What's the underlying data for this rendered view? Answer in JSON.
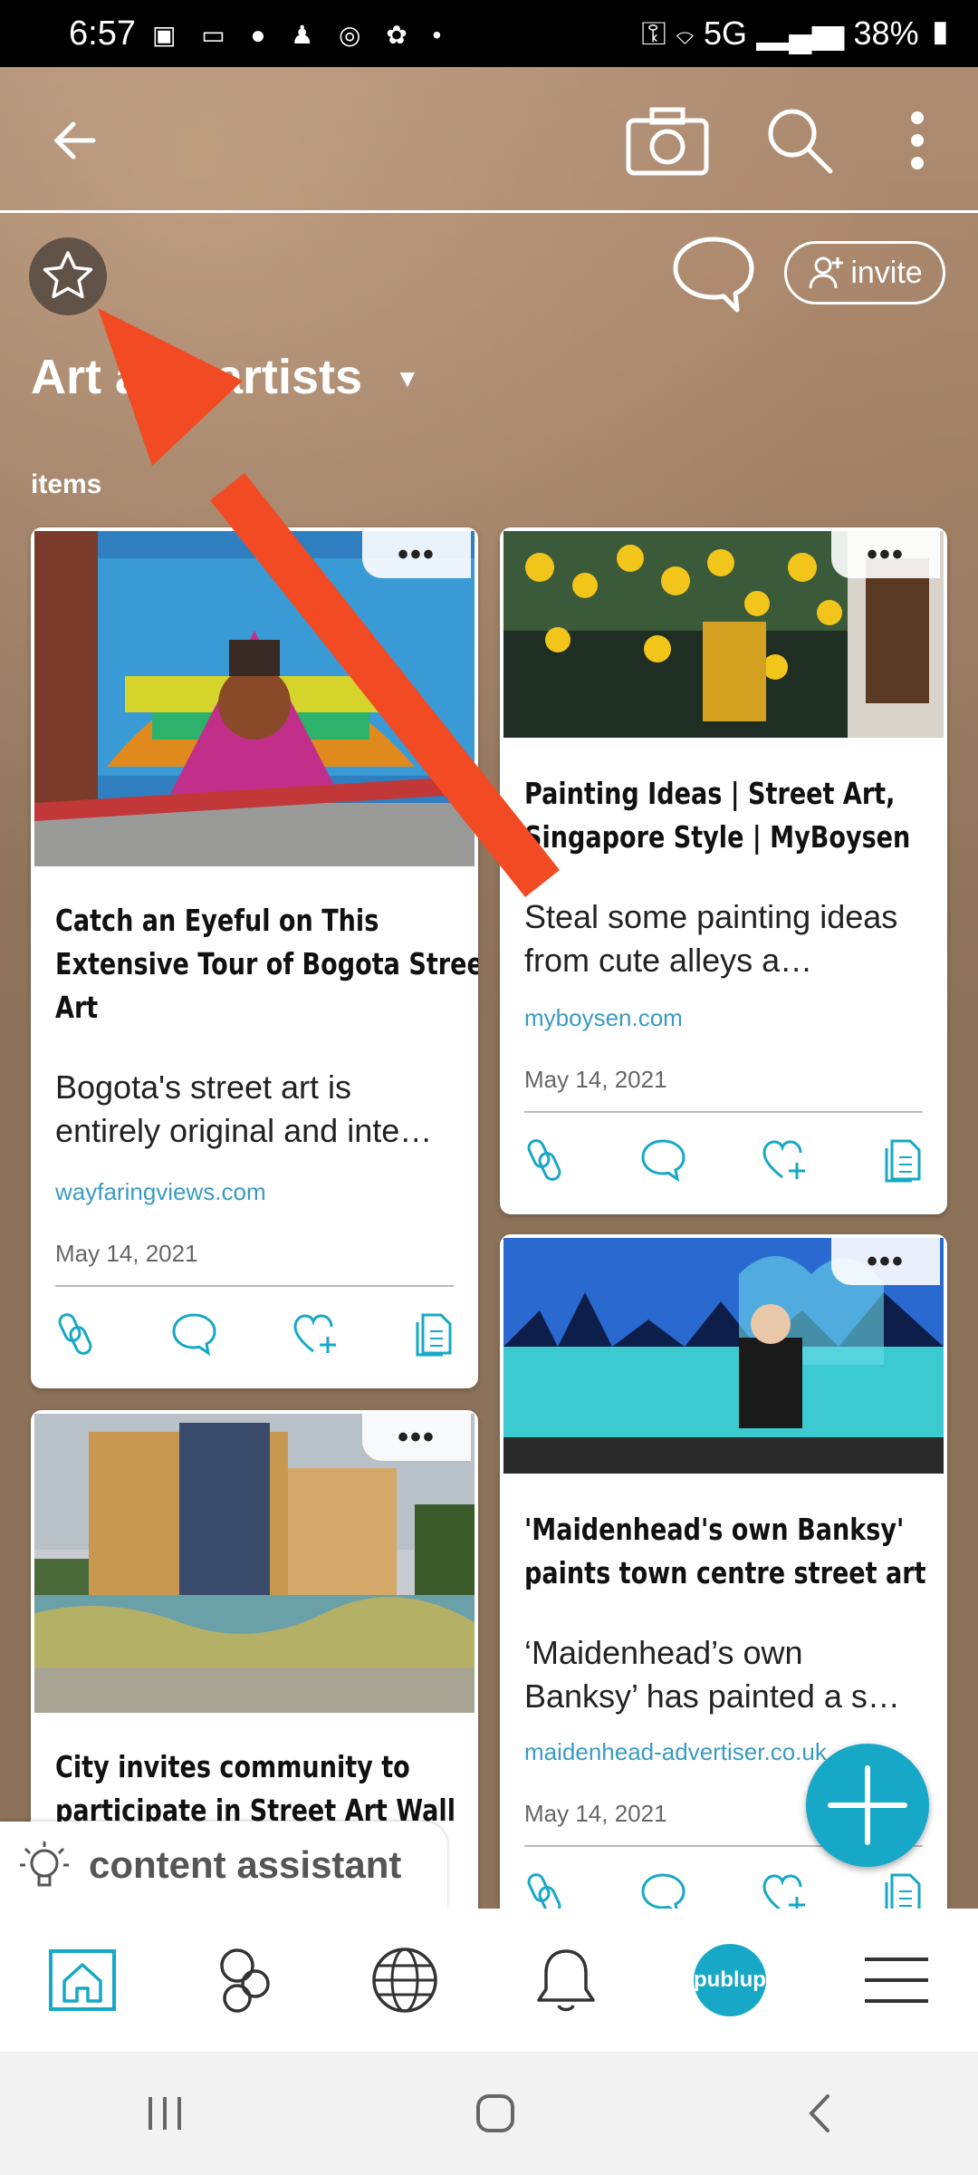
{
  "status_bar": {
    "time": "6:57",
    "network": "5G",
    "battery": "38%"
  },
  "header": {
    "invite_label": "invite",
    "title": "Art and artists"
  },
  "section_label": "items",
  "cards": [
    {
      "title": "Catch an Eyeful on This Extensive Tour of Bogota Street Art",
      "description": "Bogota's street art is entirely original and inte…",
      "source": "wayfaringviews.com",
      "date": "May 14, 2021"
    },
    {
      "title": "Painting Ideas | Street Art, Singapore Style | MyBoysen",
      "description": "Steal some painting ideas from cute alleys a…",
      "source": "myboysen.com",
      "date": "May 14, 2021"
    },
    {
      "title": "'Maidenhead's own Banksy' paints town centre street art",
      "description": "‘Maidenhead’s own Banksy’ has painted a s…",
      "source": "maidenhead-advertiser.co.uk",
      "date": "May 14, 2021"
    },
    {
      "title": "City invites community to participate in Street Art Wall",
      "description": "",
      "source": "",
      "date": ""
    }
  ],
  "more_label": "•••",
  "assistant": {
    "label": "content assistant"
  },
  "bottom_nav": {
    "brand_label": "publup"
  },
  "icons": [
    "back-arrow-icon",
    "camera-icon",
    "search-icon",
    "more-vert-icon",
    "star-icon",
    "comment-icon",
    "add-person-icon",
    "link-icon",
    "heart-plus-icon",
    "document-icon",
    "lightbulb-icon",
    "home-icon",
    "circles-icon",
    "globe-icon",
    "bell-icon",
    "menu-icon",
    "plus-icon"
  ],
  "colors": {
    "accent": "#16a8c6",
    "link": "#3a9bc2",
    "annotation_arrow": "#f24a23"
  }
}
